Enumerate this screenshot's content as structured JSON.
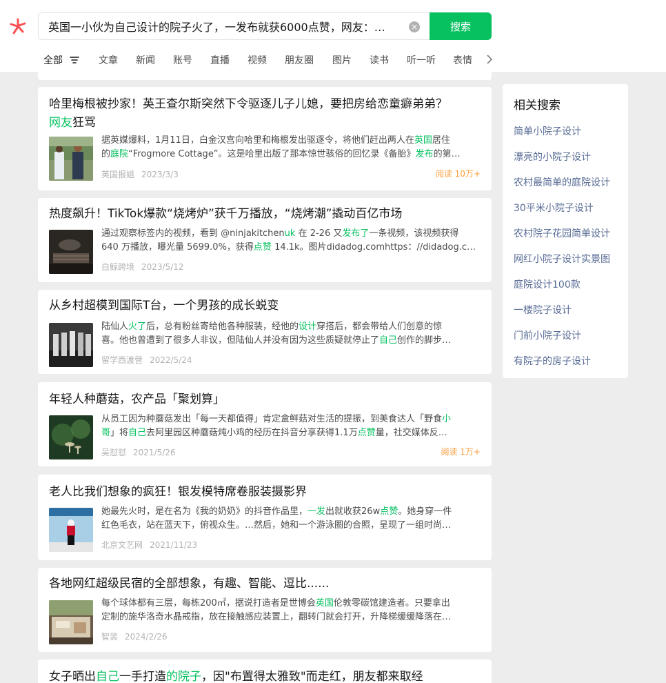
{
  "search": {
    "query": "英国一小伙为自己设计的院子火了，一发布就获6000点赞，网友：…",
    "button_label": "搜索",
    "clear_symbol": "×"
  },
  "tabs": [
    {
      "label": "全部",
      "active": true
    },
    {
      "label": "文章"
    },
    {
      "label": "新闻"
    },
    {
      "label": "账号"
    },
    {
      "label": "直播"
    },
    {
      "label": "视频"
    },
    {
      "label": "朋友圈"
    },
    {
      "label": "图片"
    },
    {
      "label": "读书"
    },
    {
      "label": "听一听"
    },
    {
      "label": "表情"
    }
  ],
  "results": [
    {
      "title_parts": [
        {
          "t": "哈里梅根被抄家！英王查尔斯突然下令驱逐儿子儿媳，要把房给恋童癖弟弟？"
        },
        {
          "t": "网友",
          "hl": true,
          "br": true
        },
        {
          "t": "狂骂"
        }
      ],
      "desc_line1": [
        {
          "t": "据英媒爆料，1月11日，白金汉宫向哈里和梅根发出驱逐令，将他们赶出两人在"
        },
        {
          "t": "英国",
          "hl": true
        },
        {
          "t": "居住"
        }
      ],
      "desc_line2": [
        {
          "t": "的"
        },
        {
          "t": "庭院",
          "hl": true
        },
        {
          "t": "“Frogmore Cottage”。这是哈里出版了那本惊世骇俗的回忆录《备胎》"
        },
        {
          "t": "发布",
          "hl": true
        },
        {
          "t": "的第…"
        }
      ],
      "source": "英国报姐",
      "date": "2023/3/3",
      "reads": "阅读 10万+"
    },
    {
      "title_parts": [
        {
          "t": "热度飙升！TikTok爆款“烧烤炉”获千万播放，“烧烤潮”撬动百亿市场"
        }
      ],
      "desc_line1": [
        {
          "t": "通过观察标签内的视频，看到 @ninjakitchen"
        },
        {
          "t": "uk",
          "hl": true
        },
        {
          "t": " 在 2-26 又"
        },
        {
          "t": "发布了",
          "hl": true
        },
        {
          "t": "一条视频，该视频获得"
        }
      ],
      "desc_line2": [
        {
          "t": "640 万播放，曝光量 5699.0%，获得"
        },
        {
          "t": "点赞",
          "hl": true
        },
        {
          "t": " 14.1k。图片didadog.comhttps：//didadog.co…"
        }
      ],
      "source": "白鲸跨境",
      "date": "2023/5/12",
      "reads": ""
    },
    {
      "title_parts": [
        {
          "t": "从乡村超模到国际T台，一个男孩的成长蜕变"
        }
      ],
      "desc_line1": [
        {
          "t": "陆仙人"
        },
        {
          "t": "火了",
          "hl": true
        },
        {
          "t": "后，总有粉丝寄给他各种服装，经他的"
        },
        {
          "t": "设计",
          "hl": true
        },
        {
          "t": "穿搭后，都会带给人们创意的惊"
        }
      ],
      "desc_line2": [
        {
          "t": "喜。他也曾遭到了很多人非议，但陆仙人并没有因为这些质疑就停止了"
        },
        {
          "t": "自己",
          "hl": true
        },
        {
          "t": "创作的脚步…"
        }
      ],
      "source": "留学西渡营",
      "date": "2022/5/24",
      "reads": ""
    },
    {
      "title_parts": [
        {
          "t": "年轻人种蘑菇，农产品「聚划算」"
        }
      ],
      "desc_line1": [
        {
          "t": "从员工因为种蘑菇发出「每一天都值得」肯定盒鲜菇对生活的提振，到美食达人「野食"
        },
        {
          "t": "小",
          "hl": true
        }
      ],
      "desc_line2": [
        {
          "t": "哥",
          "hl": true
        },
        {
          "t": "」将"
        },
        {
          "t": "自己",
          "hl": true
        },
        {
          "t": "去阿里园区种蘑菇炖小鸡的经历在抖音分享获得1.1万"
        },
        {
          "t": "点赞",
          "hl": true
        },
        {
          "t": "量，社交媒体反…"
        }
      ],
      "source": "吴怼怼",
      "date": "2021/5/26",
      "reads": "阅读 1万+"
    },
    {
      "title_parts": [
        {
          "t": "老人比我们想象的疯狂！银发模特席卷服装摄影界"
        }
      ],
      "desc_line1": [
        {
          "t": "她最先火时，是在名为《我的奶奶》的抖音作品里，"
        },
        {
          "t": "一发",
          "hl": true
        },
        {
          "t": "出就收获26w"
        },
        {
          "t": "点赞",
          "hl": true
        },
        {
          "t": "。她身穿一件"
        }
      ],
      "desc_line2": [
        {
          "t": "红色毛衣，站在蓝天下，俯视众生。…然后，她和一个游泳圈的合照，呈现了一组时尚…"
        }
      ],
      "source": "北京文艺网",
      "date": "2021/11/23",
      "reads": ""
    },
    {
      "title_parts": [
        {
          "t": "各地网红超级民宿的全部想象，有趣、智能、逗比......"
        }
      ],
      "desc_line1": [
        {
          "t": "每个球体都有三层，每栋200㎡，据说打造者是世博会"
        },
        {
          "t": "英国",
          "hl": true
        },
        {
          "t": "伦敦零碳馆建造者。只要拿出"
        }
      ],
      "desc_line2": [
        {
          "t": "定制的施华洛奇水晶戒指，放在接触感应装置上，翻转门就会打开，升降梯缓缓降落在…"
        }
      ],
      "source": "智装",
      "date": "2024/2/26",
      "reads": ""
    },
    {
      "title_parts": [
        {
          "t": "女子晒出"
        },
        {
          "t": "自己",
          "hl": true
        },
        {
          "t": "一手打造"
        },
        {
          "t": "的院子",
          "hl": true
        },
        {
          "t": "，因\"布置得太雅致\"而走红，朋友都来取经"
        }
      ],
      "desc_line1": [],
      "desc_line2": [],
      "source": "",
      "date": "",
      "reads": ""
    }
  ],
  "related": {
    "title": "相关搜索",
    "items": [
      "简单小院子设计",
      "漂亮的小院子设计",
      "农村最简单的庭院设计",
      "30平米小院子设计",
      "农村院子花园简单设计",
      "网红小院子设计实景图",
      "庭院设计100款",
      "一楼院子设计",
      "门前小院子设计",
      "有院子的房子设计"
    ]
  },
  "colors": {
    "accent": "#07c160",
    "link": "#576b95",
    "reads": "#fa9d3b",
    "page_bg": "#ededed"
  }
}
